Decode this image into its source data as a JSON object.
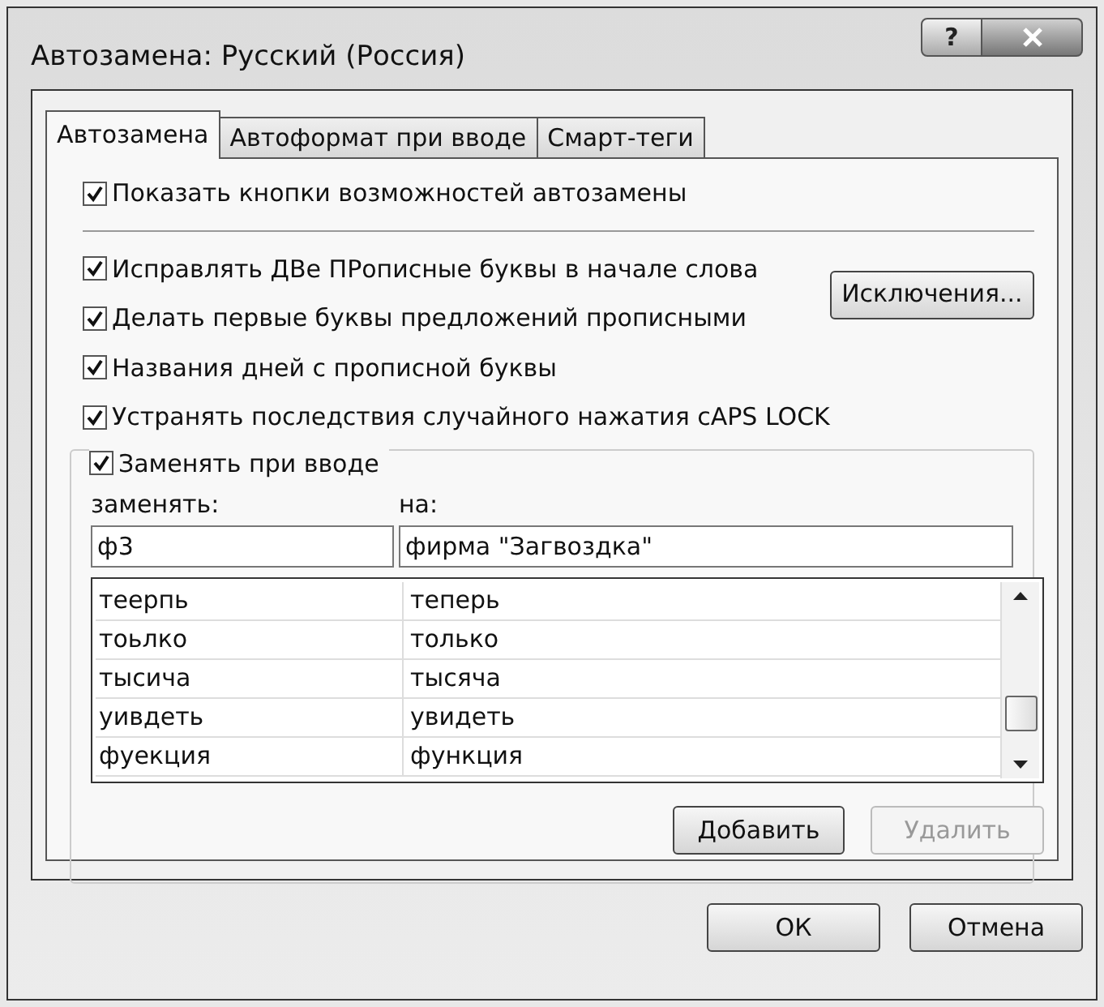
{
  "window": {
    "title": "Автозамена: Русский (Россия)",
    "help": "?"
  },
  "tabs": [
    {
      "label": "Автозамена",
      "selected": true
    },
    {
      "label": "Автоформат при вводе",
      "selected": false
    },
    {
      "label": "Смарт-теги",
      "selected": false
    }
  ],
  "show_buttons": {
    "label": "Показать кнопки возможностей автозамены",
    "checked": true
  },
  "options": [
    {
      "label": "Исправлять ДВе ПРописные буквы в начале слова",
      "checked": true
    },
    {
      "label": "Делать первые буквы предложений прописными",
      "checked": true
    },
    {
      "label": "Названия дней с прописной буквы",
      "checked": true
    },
    {
      "label": "Устранять последствия случайного нажатия cAPS LOCK",
      "checked": true
    }
  ],
  "exceptions_button": {
    "label": "Исключения..."
  },
  "replace_group": {
    "label": "Заменять при вводе",
    "checked": true,
    "replace_label": "заменять:",
    "with_label": "на:",
    "replace_value": "ф3",
    "with_value": "фирма \"Загвоздка\"",
    "rows": [
      {
        "from": "теерпь",
        "to": "теперь"
      },
      {
        "from": "тоьлко",
        "to": "только"
      },
      {
        "from": "тысича",
        "to": "тысяча"
      },
      {
        "from": "уивдеть",
        "to": "увидеть"
      },
      {
        "from": "фуекция",
        "to": "функция"
      }
    ],
    "add_button": {
      "label": "Добавить",
      "disabled": false
    },
    "delete_button": {
      "label": "Удалить",
      "disabled": true
    }
  },
  "buttons": [
    {
      "label": "ОК"
    },
    {
      "label": "Отмена"
    }
  ]
}
